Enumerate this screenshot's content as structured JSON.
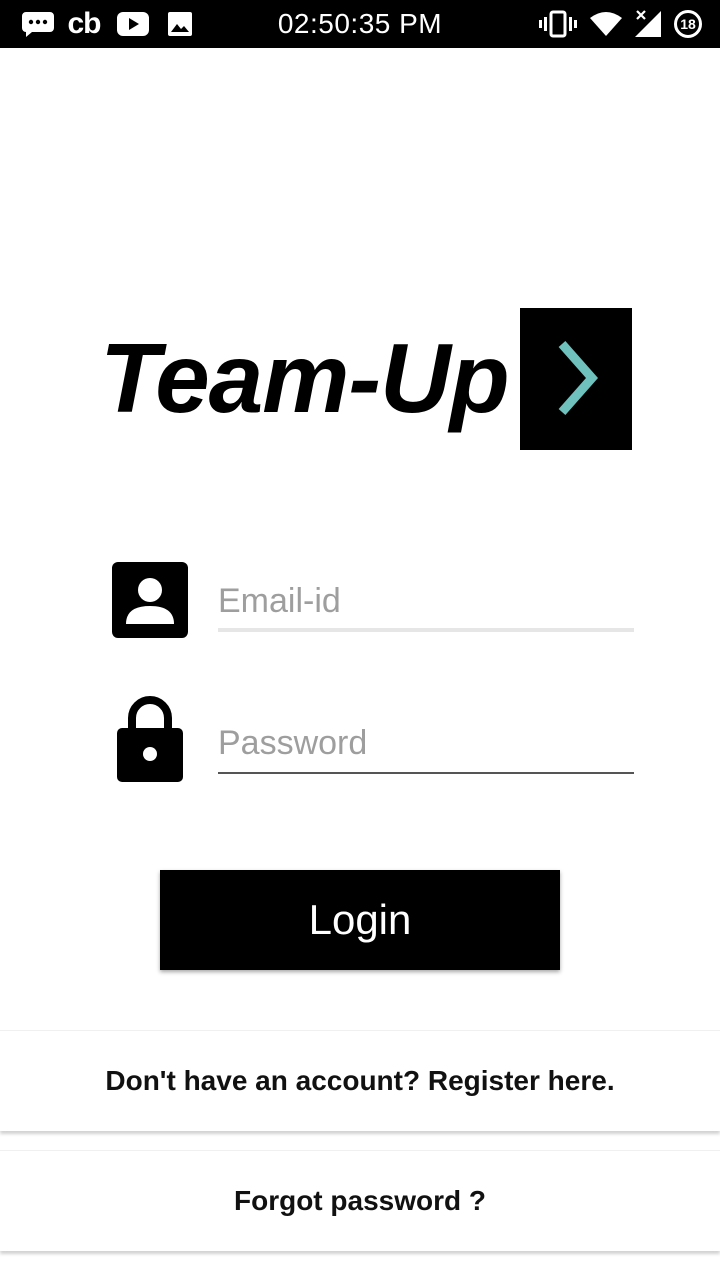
{
  "status_bar": {
    "time": "02:50:35 PM",
    "left_icons": [
      "chat-bubble-icon",
      "cb-app-icon",
      "youtube-icon",
      "image-icon"
    ],
    "cb_text": "cb",
    "right_icons": [
      "vibrate-icon",
      "wifi-icon",
      "signal-icon",
      "battery-icon"
    ],
    "battery_level": "18"
  },
  "logo": {
    "title": "Team-Up",
    "box_icon": "chevron-right-icon",
    "chevron_color": "#6fc1bd"
  },
  "form": {
    "email": {
      "placeholder": "Email-id",
      "value": "",
      "icon": "account-box-icon"
    },
    "password": {
      "placeholder": "Password",
      "value": "",
      "icon": "lock-icon"
    }
  },
  "login_button": {
    "label": "Login"
  },
  "links": {
    "register": "Don't have an account? Register here.",
    "forgot": "Forgot password ?"
  },
  "colors": {
    "primary": "#000000",
    "background": "#ffffff",
    "accent": "#6fc1bd",
    "placeholder": "#9e9e9e"
  }
}
